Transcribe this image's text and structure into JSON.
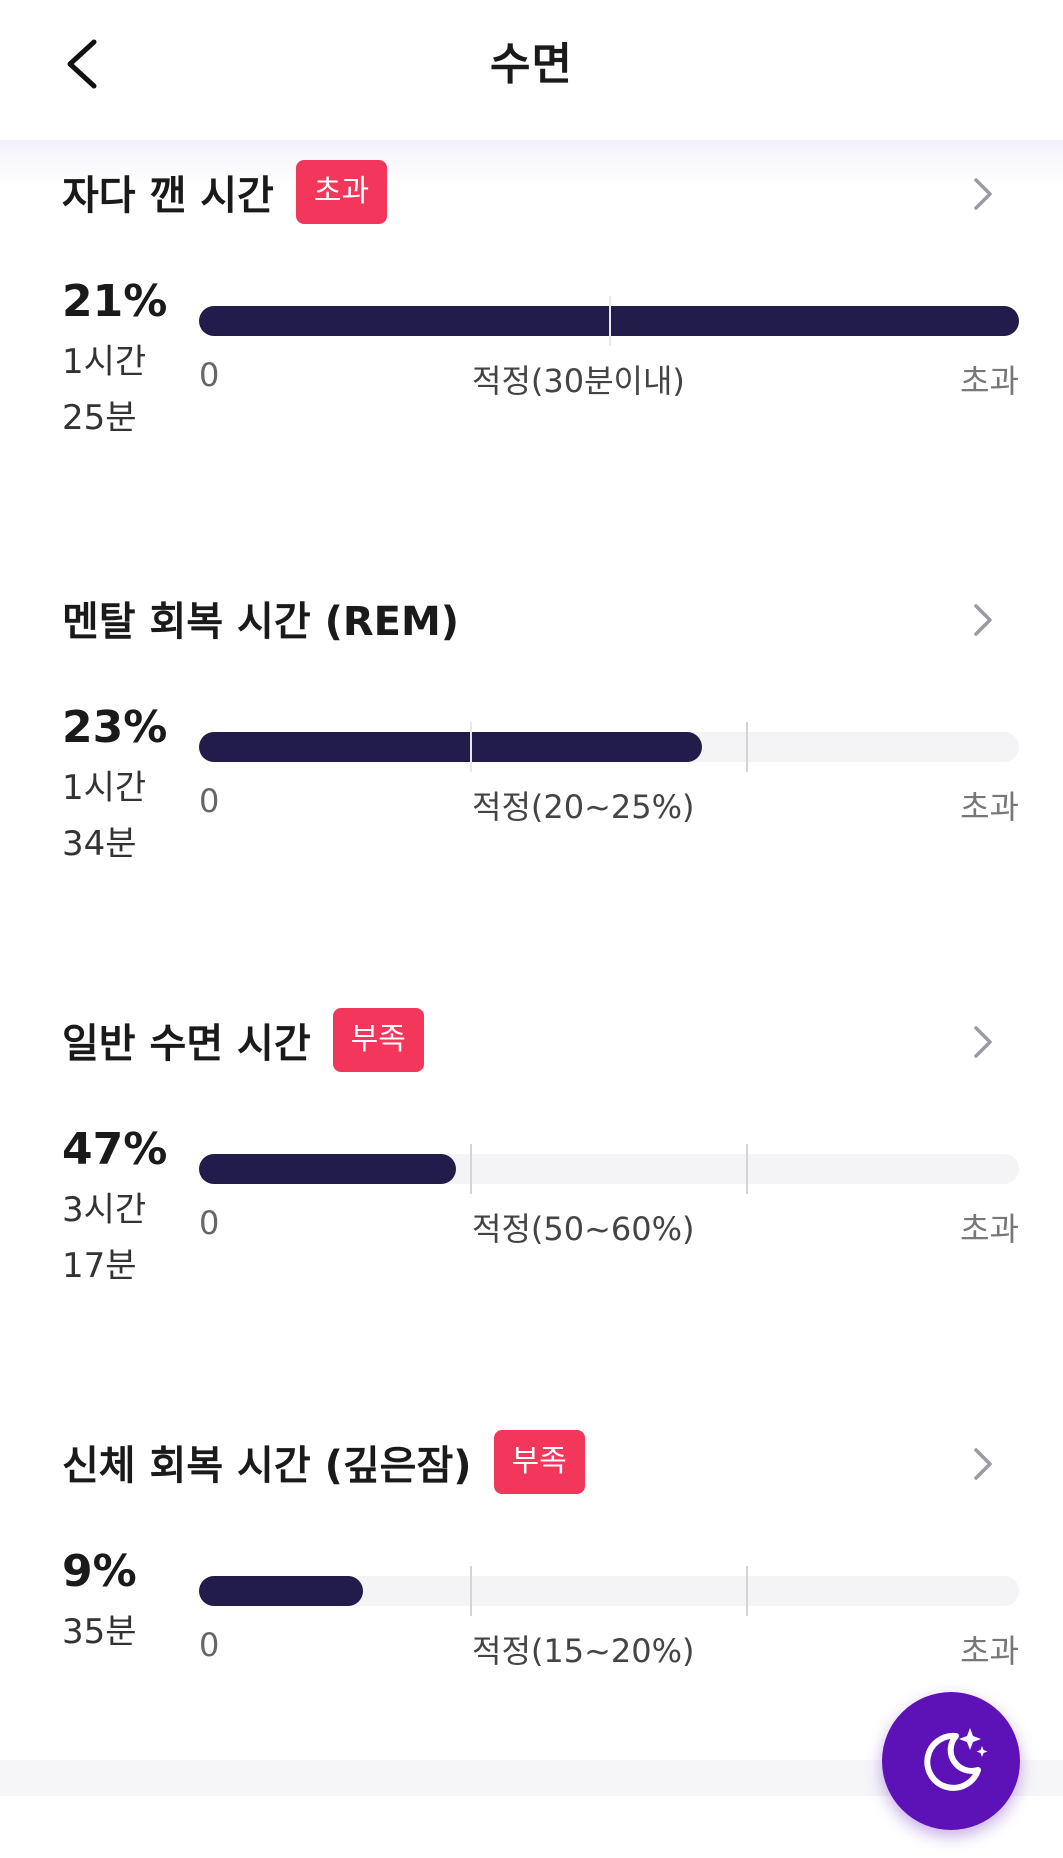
{
  "header": {
    "title": "수면",
    "back_icon": "chevron-left-icon"
  },
  "sections": [
    {
      "title": "자다 깬 시간",
      "badge": "초과",
      "percent": "21%",
      "duration_line1": "1시간",
      "duration_line2": "25분",
      "scale_zero": "0",
      "scale_mid": "적정(30분이내)",
      "scale_over": "초과",
      "bar_fill_fraction": 1.0
    },
    {
      "title": "멘탈 회복 시간 (REM)",
      "badge": "",
      "percent": "23%",
      "duration_line1": "1시간",
      "duration_line2": "34분",
      "scale_zero": "0",
      "scale_mid": "적정(20~25%)",
      "scale_over": "초과",
      "bar_fill_fraction": 0.613
    },
    {
      "title": "일반 수면 시간",
      "badge": "부족",
      "percent": "47%",
      "duration_line1": "3시간",
      "duration_line2": "17분",
      "scale_zero": "0",
      "scale_mid": "적정(50~60%)",
      "scale_over": "초과",
      "bar_fill_fraction": 0.314
    },
    {
      "title": "신체 회복 시간 (깊은잠)",
      "badge": "부족",
      "percent": "9%",
      "duration_line1": "35분",
      "duration_line2": "",
      "scale_zero": "0",
      "scale_mid": "적정(15~20%)",
      "scale_over": "초과",
      "bar_fill_fraction": 0.2
    }
  ],
  "fab": {
    "icon": "moon-stars-icon"
  },
  "colors": {
    "bar_fill": "#211c4a",
    "badge": "#f2375b",
    "fab": "#5d12b8"
  }
}
